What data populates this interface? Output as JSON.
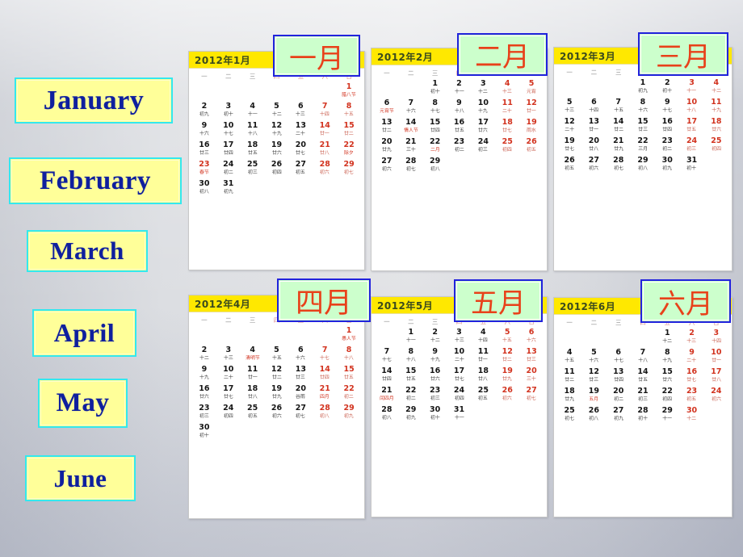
{
  "slide": {
    "background_top": "#dcdee2",
    "background_bottom": "#b9bdc9"
  },
  "english_labels": [
    {
      "text": "January",
      "name": "en-label-january"
    },
    {
      "text": "February",
      "name": "en-label-february"
    },
    {
      "text": "March",
      "name": "en-label-march"
    },
    {
      "text": "April",
      "name": "en-label-april"
    },
    {
      "text": "May",
      "name": "en-label-may"
    },
    {
      "text": "June",
      "name": "en-label-june"
    }
  ],
  "chinese_labels": [
    {
      "text": "一月"
    },
    {
      "text": "二月"
    },
    {
      "text": "三月"
    },
    {
      "text": "四月"
    },
    {
      "text": "五月"
    },
    {
      "text": "六月"
    }
  ],
  "weekday_headers": [
    "一",
    "二",
    "三",
    "四",
    "五",
    "六",
    "日"
  ],
  "colors": {
    "chip_yellow": "#ffff99",
    "chip_cyan_border": "#33e8ee",
    "chip_blue_text": "#0f1f9e",
    "cn_chip_green": "#ccffcc",
    "cn_chip_blue_border": "#2222dd",
    "cn_chip_red_text": "#e8411a",
    "cal_header_yellow": "#ffe800",
    "cal_header_text": "#3a4a1e",
    "weekend_red": "#d2331f"
  },
  "calendars": [
    {
      "title": "2012年1月",
      "lead_blanks": 6,
      "days": [
        {
          "d": "1",
          "l": "腊八节",
          "red": true,
          "fest": true
        },
        {
          "d": "2",
          "l": "初九"
        },
        {
          "d": "3",
          "l": "初十"
        },
        {
          "d": "4",
          "l": "十一"
        },
        {
          "d": "5",
          "l": "十二"
        },
        {
          "d": "6",
          "l": "十三"
        },
        {
          "d": "7",
          "l": "十四",
          "red": true
        },
        {
          "d": "8",
          "l": "十五",
          "red": true
        },
        {
          "d": "9",
          "l": "十六"
        },
        {
          "d": "10",
          "l": "十七"
        },
        {
          "d": "11",
          "l": "十八"
        },
        {
          "d": "12",
          "l": "十九"
        },
        {
          "d": "13",
          "l": "二十"
        },
        {
          "d": "14",
          "l": "廿一",
          "red": true
        },
        {
          "d": "15",
          "l": "廿二",
          "red": true
        },
        {
          "d": "16",
          "l": "廿三"
        },
        {
          "d": "17",
          "l": "廿四"
        },
        {
          "d": "18",
          "l": "廿五"
        },
        {
          "d": "19",
          "l": "廿六"
        },
        {
          "d": "20",
          "l": "廿七"
        },
        {
          "d": "21",
          "l": "廿八",
          "red": true
        },
        {
          "d": "22",
          "l": "除夕",
          "red": true,
          "fest": true
        },
        {
          "d": "23",
          "l": "春节",
          "red": true,
          "fest": true
        },
        {
          "d": "24",
          "l": "初二"
        },
        {
          "d": "25",
          "l": "初三"
        },
        {
          "d": "26",
          "l": "初四"
        },
        {
          "d": "27",
          "l": "初五"
        },
        {
          "d": "28",
          "l": "初六",
          "red": true
        },
        {
          "d": "29",
          "l": "初七",
          "red": true
        },
        {
          "d": "30",
          "l": "初八"
        },
        {
          "d": "31",
          "l": "初九"
        }
      ]
    },
    {
      "title": "2012年2月",
      "lead_blanks": 2,
      "days": [
        {
          "d": "1",
          "l": "初十"
        },
        {
          "d": "2",
          "l": "十一"
        },
        {
          "d": "3",
          "l": "十二"
        },
        {
          "d": "4",
          "l": "十三",
          "red": true
        },
        {
          "d": "5",
          "l": "元宵",
          "red": true
        },
        {
          "d": "6",
          "l": "元宵节",
          "fest": true
        },
        {
          "d": "7",
          "l": "十六"
        },
        {
          "d": "8",
          "l": "十七"
        },
        {
          "d": "9",
          "l": "十八"
        },
        {
          "d": "10",
          "l": "十九"
        },
        {
          "d": "11",
          "l": "二十",
          "red": true
        },
        {
          "d": "12",
          "l": "廿一",
          "red": true
        },
        {
          "d": "13",
          "l": "廿二"
        },
        {
          "d": "14",
          "l": "情人节",
          "fest": true
        },
        {
          "d": "15",
          "l": "廿四"
        },
        {
          "d": "16",
          "l": "廿五"
        },
        {
          "d": "17",
          "l": "廿六"
        },
        {
          "d": "18",
          "l": "廿七",
          "red": true
        },
        {
          "d": "19",
          "l": "雨水",
          "red": true
        },
        {
          "d": "20",
          "l": "廿九"
        },
        {
          "d": "21",
          "l": "三十"
        },
        {
          "d": "22",
          "l": "二月",
          "fest": true
        },
        {
          "d": "23",
          "l": "初二"
        },
        {
          "d": "24",
          "l": "初三"
        },
        {
          "d": "25",
          "l": "初四",
          "red": true
        },
        {
          "d": "26",
          "l": "初五",
          "red": true
        },
        {
          "d": "27",
          "l": "初六"
        },
        {
          "d": "28",
          "l": "初七"
        },
        {
          "d": "29",
          "l": "初八"
        }
      ]
    },
    {
      "title": "2012年3月",
      "lead_blanks": 3,
      "days": [
        {
          "d": "1",
          "l": "初九"
        },
        {
          "d": "2",
          "l": "初十"
        },
        {
          "d": "3",
          "l": "十一",
          "red": true
        },
        {
          "d": "4",
          "l": "十二",
          "red": true
        },
        {
          "d": "5",
          "l": "十三"
        },
        {
          "d": "6",
          "l": "十四"
        },
        {
          "d": "7",
          "l": "十五"
        },
        {
          "d": "8",
          "l": "十六"
        },
        {
          "d": "9",
          "l": "十七"
        },
        {
          "d": "10",
          "l": "十八",
          "red": true
        },
        {
          "d": "11",
          "l": "十九",
          "red": true
        },
        {
          "d": "12",
          "l": "二十"
        },
        {
          "d": "13",
          "l": "廿一"
        },
        {
          "d": "14",
          "l": "廿二"
        },
        {
          "d": "15",
          "l": "廿三"
        },
        {
          "d": "16",
          "l": "廿四"
        },
        {
          "d": "17",
          "l": "廿五",
          "red": true
        },
        {
          "d": "18",
          "l": "廿六",
          "red": true
        },
        {
          "d": "19",
          "l": "廿七"
        },
        {
          "d": "20",
          "l": "廿八"
        },
        {
          "d": "21",
          "l": "廿九"
        },
        {
          "d": "22",
          "l": "三月"
        },
        {
          "d": "23",
          "l": "初二"
        },
        {
          "d": "24",
          "l": "初三",
          "red": true
        },
        {
          "d": "25",
          "l": "初四",
          "red": true
        },
        {
          "d": "26",
          "l": "初五"
        },
        {
          "d": "27",
          "l": "初六"
        },
        {
          "d": "28",
          "l": "初七"
        },
        {
          "d": "29",
          "l": "初八"
        },
        {
          "d": "30",
          "l": "初九"
        },
        {
          "d": "31",
          "l": "初十"
        }
      ]
    },
    {
      "title": "2012年4月",
      "lead_blanks": 6,
      "days": [
        {
          "d": "1",
          "l": "愚人节",
          "red": true,
          "fest": true
        },
        {
          "d": "2",
          "l": "十二"
        },
        {
          "d": "3",
          "l": "十三"
        },
        {
          "d": "4",
          "l": "清明节",
          "fest": true
        },
        {
          "d": "5",
          "l": "十五"
        },
        {
          "d": "6",
          "l": "十六"
        },
        {
          "d": "7",
          "l": "十七",
          "red": true
        },
        {
          "d": "8",
          "l": "十八",
          "red": true
        },
        {
          "d": "9",
          "l": "十九"
        },
        {
          "d": "10",
          "l": "二十"
        },
        {
          "d": "11",
          "l": "廿一"
        },
        {
          "d": "12",
          "l": "廿二"
        },
        {
          "d": "13",
          "l": "廿三"
        },
        {
          "d": "14",
          "l": "廿四",
          "red": true
        },
        {
          "d": "15",
          "l": "廿五",
          "red": true
        },
        {
          "d": "16",
          "l": "廿六"
        },
        {
          "d": "17",
          "l": "廿七"
        },
        {
          "d": "18",
          "l": "廿八"
        },
        {
          "d": "19",
          "l": "廿九"
        },
        {
          "d": "20",
          "l": "谷雨"
        },
        {
          "d": "21",
          "l": "四月",
          "red": true,
          "fest": true
        },
        {
          "d": "22",
          "l": "初二",
          "red": true
        },
        {
          "d": "23",
          "l": "初三"
        },
        {
          "d": "24",
          "l": "初四"
        },
        {
          "d": "25",
          "l": "初五"
        },
        {
          "d": "26",
          "l": "初六"
        },
        {
          "d": "27",
          "l": "初七"
        },
        {
          "d": "28",
          "l": "初八",
          "red": true
        },
        {
          "d": "29",
          "l": "初九",
          "red": true
        },
        {
          "d": "30",
          "l": "初十"
        }
      ]
    },
    {
      "title": "2012年5月",
      "lead_blanks": 1,
      "days": [
        {
          "d": "1",
          "l": "十一"
        },
        {
          "d": "2",
          "l": "十二"
        },
        {
          "d": "3",
          "l": "十三"
        },
        {
          "d": "4",
          "l": "十四"
        },
        {
          "d": "5",
          "l": "十五",
          "red": true
        },
        {
          "d": "6",
          "l": "十六",
          "red": true
        },
        {
          "d": "7",
          "l": "十七"
        },
        {
          "d": "8",
          "l": "十八"
        },
        {
          "d": "9",
          "l": "十九"
        },
        {
          "d": "10",
          "l": "二十"
        },
        {
          "d": "11",
          "l": "廿一"
        },
        {
          "d": "12",
          "l": "廿二",
          "red": true
        },
        {
          "d": "13",
          "l": "廿三",
          "red": true
        },
        {
          "d": "14",
          "l": "廿四"
        },
        {
          "d": "15",
          "l": "廿五"
        },
        {
          "d": "16",
          "l": "廿六"
        },
        {
          "d": "17",
          "l": "廿七"
        },
        {
          "d": "18",
          "l": "廿八"
        },
        {
          "d": "19",
          "l": "廿九",
          "red": true
        },
        {
          "d": "20",
          "l": "三十",
          "red": true
        },
        {
          "d": "21",
          "l": "闰四月",
          "fest": true
        },
        {
          "d": "22",
          "l": "初二"
        },
        {
          "d": "23",
          "l": "初三"
        },
        {
          "d": "24",
          "l": "初四"
        },
        {
          "d": "25",
          "l": "初五"
        },
        {
          "d": "26",
          "l": "初六",
          "red": true
        },
        {
          "d": "27",
          "l": "初七",
          "red": true
        },
        {
          "d": "28",
          "l": "初八"
        },
        {
          "d": "29",
          "l": "初九"
        },
        {
          "d": "30",
          "l": "初十"
        },
        {
          "d": "31",
          "l": "十一"
        }
      ]
    },
    {
      "title": "2012年6月",
      "lead_blanks": 4,
      "days": [
        {
          "d": "1",
          "l": "十二"
        },
        {
          "d": "2",
          "l": "十三",
          "red": true
        },
        {
          "d": "3",
          "l": "十四",
          "red": true
        },
        {
          "d": "4",
          "l": "十五"
        },
        {
          "d": "5",
          "l": "十六"
        },
        {
          "d": "6",
          "l": "十七"
        },
        {
          "d": "7",
          "l": "十八"
        },
        {
          "d": "8",
          "l": "十九"
        },
        {
          "d": "9",
          "l": "二十",
          "red": true
        },
        {
          "d": "10",
          "l": "廿一",
          "red": true
        },
        {
          "d": "11",
          "l": "廿二"
        },
        {
          "d": "12",
          "l": "廿三"
        },
        {
          "d": "13",
          "l": "廿四"
        },
        {
          "d": "14",
          "l": "廿五"
        },
        {
          "d": "15",
          "l": "廿六"
        },
        {
          "d": "16",
          "l": "廿七",
          "red": true
        },
        {
          "d": "17",
          "l": "廿八",
          "red": true
        },
        {
          "d": "18",
          "l": "廿九"
        },
        {
          "d": "19",
          "l": "五月",
          "fest": true
        },
        {
          "d": "20",
          "l": "初二"
        },
        {
          "d": "21",
          "l": "初三"
        },
        {
          "d": "22",
          "l": "初四"
        },
        {
          "d": "23",
          "l": "初五",
          "red": true
        },
        {
          "d": "24",
          "l": "初六",
          "red": true
        },
        {
          "d": "25",
          "l": "初七"
        },
        {
          "d": "26",
          "l": "初八"
        },
        {
          "d": "27",
          "l": "初九"
        },
        {
          "d": "28",
          "l": "初十"
        },
        {
          "d": "29",
          "l": "十一"
        },
        {
          "d": "30",
          "l": "十二",
          "red": true
        }
      ]
    }
  ]
}
